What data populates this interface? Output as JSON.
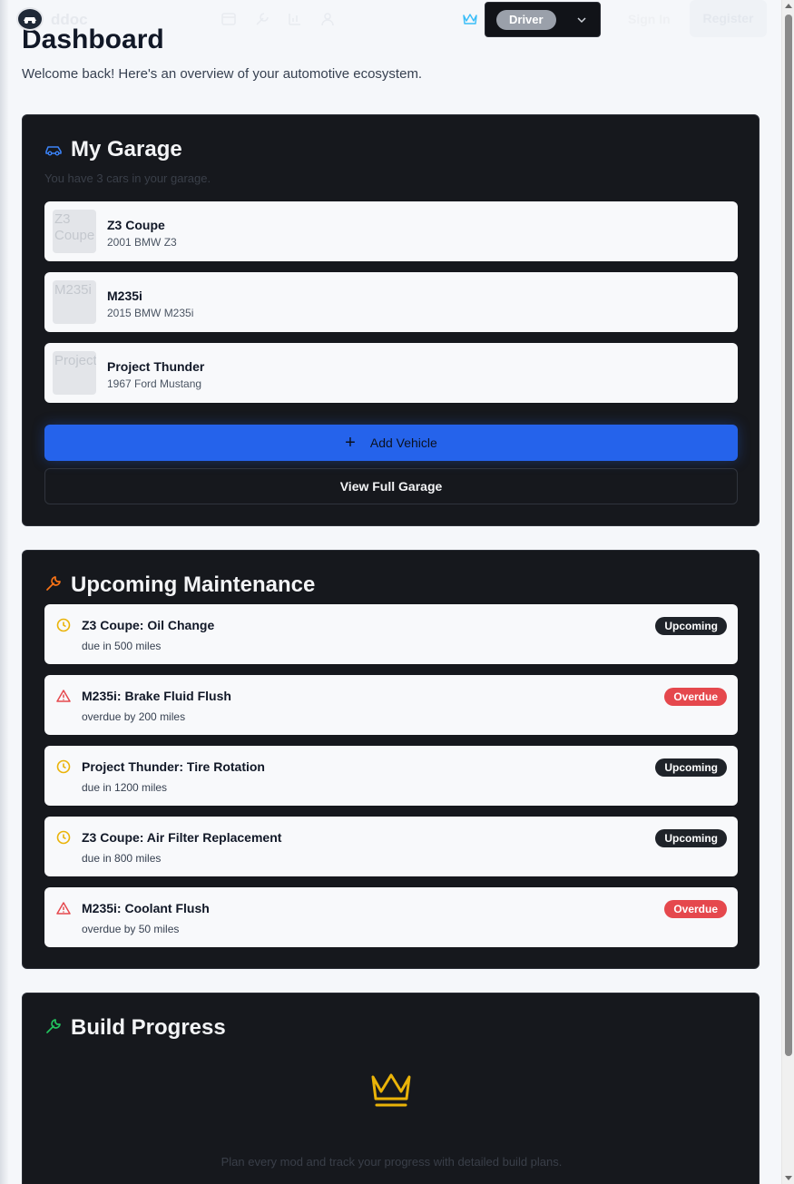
{
  "nav": {
    "logo_text": "ddoc",
    "tier": "Driver",
    "sign_in": "Sign In",
    "register": "Register"
  },
  "page": {
    "title": "Dashboard",
    "subtitle": "Welcome back! Here's an overview of your automotive ecosystem."
  },
  "garage": {
    "title": "My Garage",
    "subtitle": "You have 3 cars in your garage.",
    "cars": [
      {
        "name": "Z3 Coupe",
        "desc": "2001 BMW Z3",
        "img_alt": "Z3 Coupe"
      },
      {
        "name": "M235i",
        "desc": "2015 BMW M235i",
        "img_alt": "M235i"
      },
      {
        "name": "Project Thunder",
        "desc": "1967 Ford Mustang",
        "img_alt": "Project"
      }
    ],
    "add_label": "Add Vehicle",
    "view_label": "View Full Garage"
  },
  "maintenance": {
    "title": "Upcoming Maintenance",
    "items": [
      {
        "title": "Z3 Coupe: Oil Change",
        "desc": "due in 500 miles",
        "status": "Upcoming"
      },
      {
        "title": "M235i: Brake Fluid Flush",
        "desc": "overdue by 200 miles",
        "status": "Overdue"
      },
      {
        "title": "Project Thunder: Tire Rotation",
        "desc": "due in 1200 miles",
        "status": "Upcoming"
      },
      {
        "title": "Z3 Coupe: Air Filter Replacement",
        "desc": "due in 800 miles",
        "status": "Upcoming"
      },
      {
        "title": "M235i: Coolant Flush",
        "desc": "overdue by 50 miles",
        "status": "Overdue"
      }
    ]
  },
  "build": {
    "title": "Build Progress",
    "subtitle": "Plan every mod and track your progress with detailed build plans."
  },
  "colors": {
    "accent_blue": "#2563eb",
    "overdue_red": "#e5484d",
    "upcoming_amber": "#eab308",
    "maintenance_orange": "#f97316",
    "build_green": "#22c55e"
  }
}
